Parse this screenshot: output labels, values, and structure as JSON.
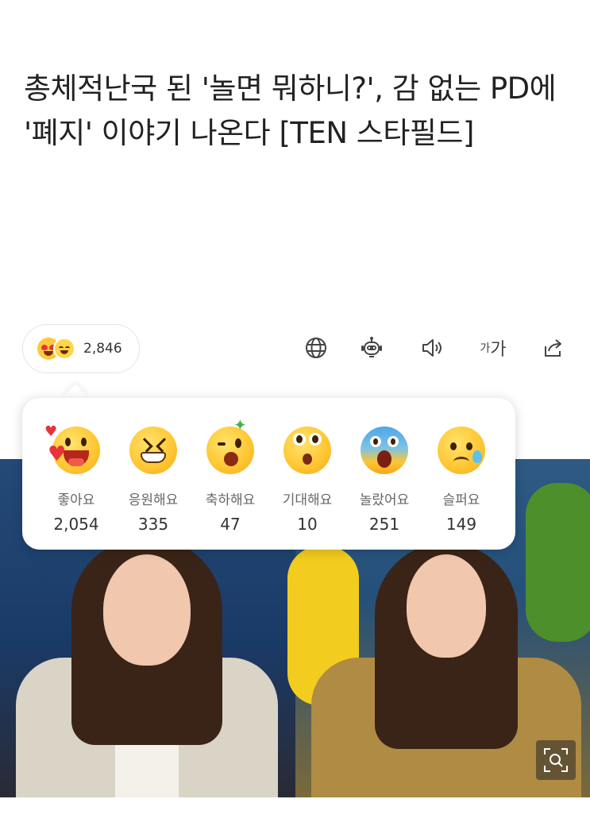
{
  "article": {
    "headline": "총체적난국 된 '놀면 뭐하니?', 감 없는 PD에 '폐지' 이야기 나온다 [TEN 스타필드]"
  },
  "reaction_summary": {
    "total_count": "2,846"
  },
  "toolbar": {
    "globe_icon": "globe-icon",
    "robot_icon": "robot-icon",
    "speaker_icon": "speaker-icon",
    "font_size_small": "가",
    "font_size_large": "가",
    "share_icon": "share-icon"
  },
  "reactions": [
    {
      "label": "좋아요",
      "count": "2,054",
      "icon": "love-face-icon"
    },
    {
      "label": "응원해요",
      "count": "335",
      "icon": "cheer-face-icon"
    },
    {
      "label": "축하해요",
      "count": "47",
      "icon": "party-face-icon"
    },
    {
      "label": "기대해요",
      "count": "10",
      "icon": "expect-face-icon"
    },
    {
      "label": "놀랐어요",
      "count": "251",
      "icon": "surprised-face-icon"
    },
    {
      "label": "슬퍼요",
      "count": "149",
      "icon": "sad-face-icon"
    }
  ],
  "colors": {
    "emoji_yellow": "#ffc531",
    "heart_red": "#e8323c",
    "photo_bg_blue": "#1d3d66"
  }
}
